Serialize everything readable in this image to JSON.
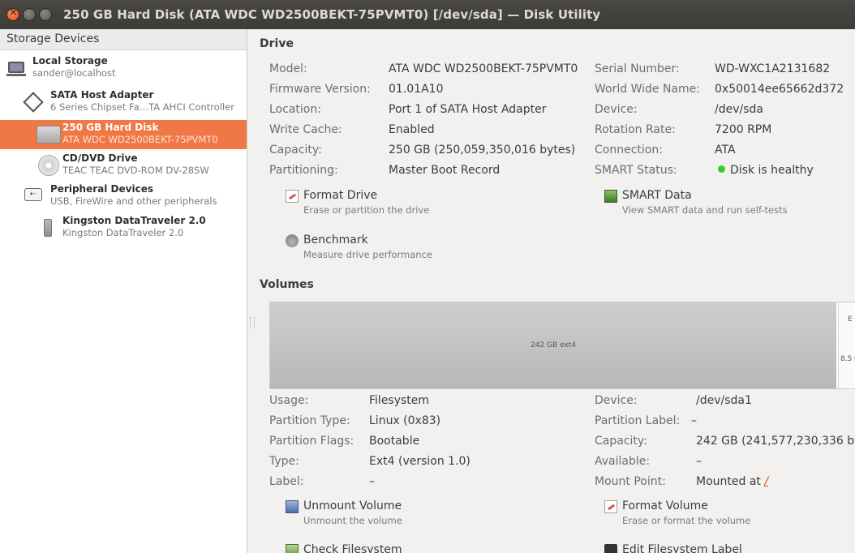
{
  "window": {
    "title": "250 GB Hard Disk (ATA WDC WD2500BEKT-75PVMT0) [/dev/sda] — Disk Utility"
  },
  "sidebar": {
    "header": "Storage Devices",
    "items": [
      {
        "name": "Local Storage",
        "sub": "sander@localhost",
        "icon": "laptop-icon"
      },
      {
        "name": "SATA Host Adapter",
        "sub": "6 Series Chipset Fa…TA AHCI Controller",
        "icon": "host-adapter-icon"
      },
      {
        "name": "250 GB Hard Disk",
        "sub": "ATA WDC WD2500BEKT-75PVMT0",
        "icon": "hard-disk-icon",
        "selected": true
      },
      {
        "name": "CD/DVD Drive",
        "sub": "TEAC TEAC DVD-ROM DV-28SW",
        "icon": "optical-disc-icon"
      },
      {
        "name": "Peripheral Devices",
        "sub": "USB, FireWire and other peripherals",
        "icon": "usb-icon"
      },
      {
        "name": "Kingston DataTraveler 2.0",
        "sub": "Kingston DataTraveler 2.0",
        "icon": "usb-stick-icon"
      }
    ]
  },
  "drive": {
    "title": "Drive",
    "left": [
      {
        "k": "Model:",
        "v": "ATA WDC WD2500BEKT-75PVMT0"
      },
      {
        "k": "Firmware Version:",
        "v": "01.01A10"
      },
      {
        "k": "Location:",
        "v": "Port 1 of SATA Host Adapter"
      },
      {
        "k": "Write Cache:",
        "v": "Enabled"
      },
      {
        "k": "Capacity:",
        "v": "250 GB (250,059,350,016 bytes)"
      },
      {
        "k": "Partitioning:",
        "v": "Master Boot Record"
      }
    ],
    "right": [
      {
        "k": "Serial Number:",
        "v": "WD-WXC1A2131682"
      },
      {
        "k": "World Wide Name:",
        "v": "0x50014ee65662d372"
      },
      {
        "k": "Device:",
        "v": "/dev/sda"
      },
      {
        "k": "Rotation Rate:",
        "v": "7200 RPM"
      },
      {
        "k": "Connection:",
        "v": "ATA"
      },
      {
        "k": "SMART Status:",
        "v": "Disk is healthy"
      }
    ],
    "actions": {
      "format": {
        "label": "Format Drive",
        "desc": "Erase or partition the drive"
      },
      "smart": {
        "label": "SMART Data",
        "desc": "View SMART data and run self-tests"
      },
      "benchmark": {
        "label": "Benchmark",
        "desc": "Measure drive performance"
      }
    }
  },
  "volumes": {
    "title": "Volumes",
    "map": {
      "main_label": "242 GB ext4",
      "ext_label_a": "E",
      "ext_label_b": "8.5 G"
    },
    "left": [
      {
        "k": "Usage:",
        "v": "Filesystem"
      },
      {
        "k": "Partition Type:",
        "v": "Linux (0x83)"
      },
      {
        "k": "Partition Flags:",
        "v": "Bootable"
      },
      {
        "k": "Type:",
        "v": "Ext4 (version 1.0)"
      },
      {
        "k": "Label:",
        "v": "–"
      }
    ],
    "right": [
      {
        "k": "Device:",
        "v": "/dev/sda1"
      },
      {
        "k": "Partition Label:",
        "v": "–"
      },
      {
        "k": "Capacity:",
        "v": "242 GB (241,577,230,336 by"
      },
      {
        "k": "Available:",
        "v": "–"
      },
      {
        "k": "Mount Point:",
        "v": "Mounted at ",
        "link": "/"
      }
    ],
    "actions": {
      "unmount": {
        "label": "Unmount Volume",
        "desc": "Unmount the volume"
      },
      "format_volume": {
        "label": "Format Volume",
        "desc": "Erase or format the volume"
      },
      "check": {
        "label": "Check Filesystem"
      },
      "edit_label": {
        "label": "Edit Filesystem Label"
      }
    }
  },
  "colors": {
    "selection": "#f07746",
    "healthy": "#33cc33",
    "titlebar": "#3c3b37"
  }
}
